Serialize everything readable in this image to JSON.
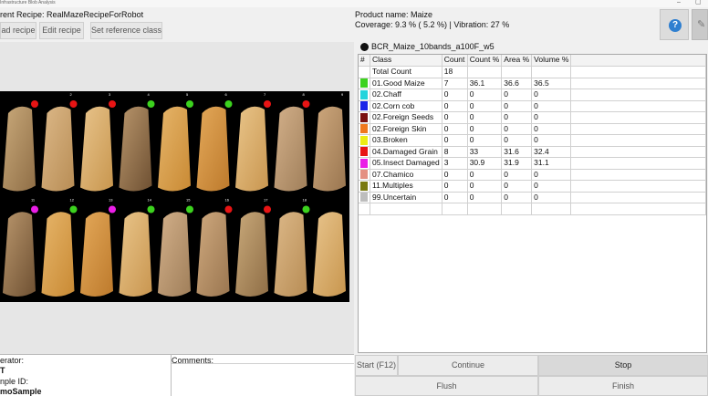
{
  "window": {
    "title": "Infrastructure Blob Analysis",
    "controls": [
      "–",
      "▢"
    ]
  },
  "recipe": {
    "current_label": "rent Recipe: RealMazeRecipeForRobot"
  },
  "toolbar": {
    "load": "ad recipe",
    "edit": "Edit recipe",
    "reference": "Set reference class"
  },
  "product": {
    "line": "Product name:  Maize",
    "coverage": "Coverage:  9.3 % ( 5.2 %) | Vibration:  27 %"
  },
  "help_label": "?",
  "dataset_name": "BCR_Maize_10bands_a100F_w5",
  "table": {
    "headers": [
      "#",
      "Class",
      "Count",
      "Count %",
      "Area %",
      "Volume %"
    ],
    "rows": [
      {
        "color": "",
        "class": "Total Count",
        "count": "18",
        "count_pct": "",
        "area_pct": "",
        "volume_pct": ""
      },
      {
        "color": "#3cd21e",
        "class": "01.Good Maize",
        "count": "7",
        "count_pct": "36.1",
        "area_pct": "36.6",
        "volume_pct": "36.5"
      },
      {
        "color": "#22d4dc",
        "class": "02.Chaff",
        "count": "0",
        "count_pct": "0",
        "area_pct": "0",
        "volume_pct": "0"
      },
      {
        "color": "#1a24e8",
        "class": "02.Corn cob",
        "count": "0",
        "count_pct": "0",
        "area_pct": "0",
        "volume_pct": "0"
      },
      {
        "color": "#7a1010",
        "class": "02.Foreign Seeds",
        "count": "0",
        "count_pct": "0",
        "area_pct": "0",
        "volume_pct": "0"
      },
      {
        "color": "#f0781e",
        "class": "02.Foreign Skin",
        "count": "0",
        "count_pct": "0",
        "area_pct": "0",
        "volume_pct": "0"
      },
      {
        "color": "#ecec14",
        "class": "03.Broken",
        "count": "0",
        "count_pct": "0",
        "area_pct": "0",
        "volume_pct": "0"
      },
      {
        "color": "#e81414",
        "class": "04.Damaged Grain",
        "count": "8",
        "count_pct": "33",
        "area_pct": "31.6",
        "volume_pct": "32.4"
      },
      {
        "color": "#ea1ee6",
        "class": "05.Insect Damaged",
        "count": "3",
        "count_pct": "30.9",
        "area_pct": "31.9",
        "volume_pct": "31.1"
      },
      {
        "color": "#e49082",
        "class": "07.Chamico",
        "count": "0",
        "count_pct": "0",
        "area_pct": "0",
        "volume_pct": "0"
      },
      {
        "color": "#7a7a10",
        "class": "11.Multiples",
        "count": "0",
        "count_pct": "0",
        "area_pct": "0",
        "volume_pct": "0"
      },
      {
        "color": "#bdbdbd",
        "class": "99.Uncertain",
        "count": "0",
        "count_pct": "0",
        "area_pct": "0",
        "volume_pct": "0"
      }
    ]
  },
  "grains": {
    "top_row_numbers": [
      "",
      "2",
      "3",
      "4",
      "5",
      "6",
      "7",
      "8",
      "9"
    ],
    "bottom_row_numbers": [
      "11",
      "12",
      "13",
      "14",
      "15",
      "16",
      "17",
      "18",
      ""
    ],
    "top_row_marker_colors": [
      "#e81414",
      "#e81414",
      "#e81414",
      "#3cd21e",
      "#3cd21e",
      "#3cd21e",
      "#e81414",
      "#e81414",
      ""
    ],
    "bottom_row_marker_colors": [
      "#ea1ee6",
      "#3cd21e",
      "#ea1ee6",
      "#3cd21e",
      "#3cd21e",
      "#e81414",
      "#e81414",
      "#3cd21e",
      ""
    ]
  },
  "bottom": {
    "operator_label": "erator:",
    "operator_value": "T",
    "sample_label": "nple ID:",
    "sample_value": "moSample",
    "comments_label": "Comments:"
  },
  "controls": {
    "start": "Start (F12)",
    "continue": "Continue",
    "stop": "Stop",
    "flush": "Flush",
    "finish": "Finish"
  }
}
